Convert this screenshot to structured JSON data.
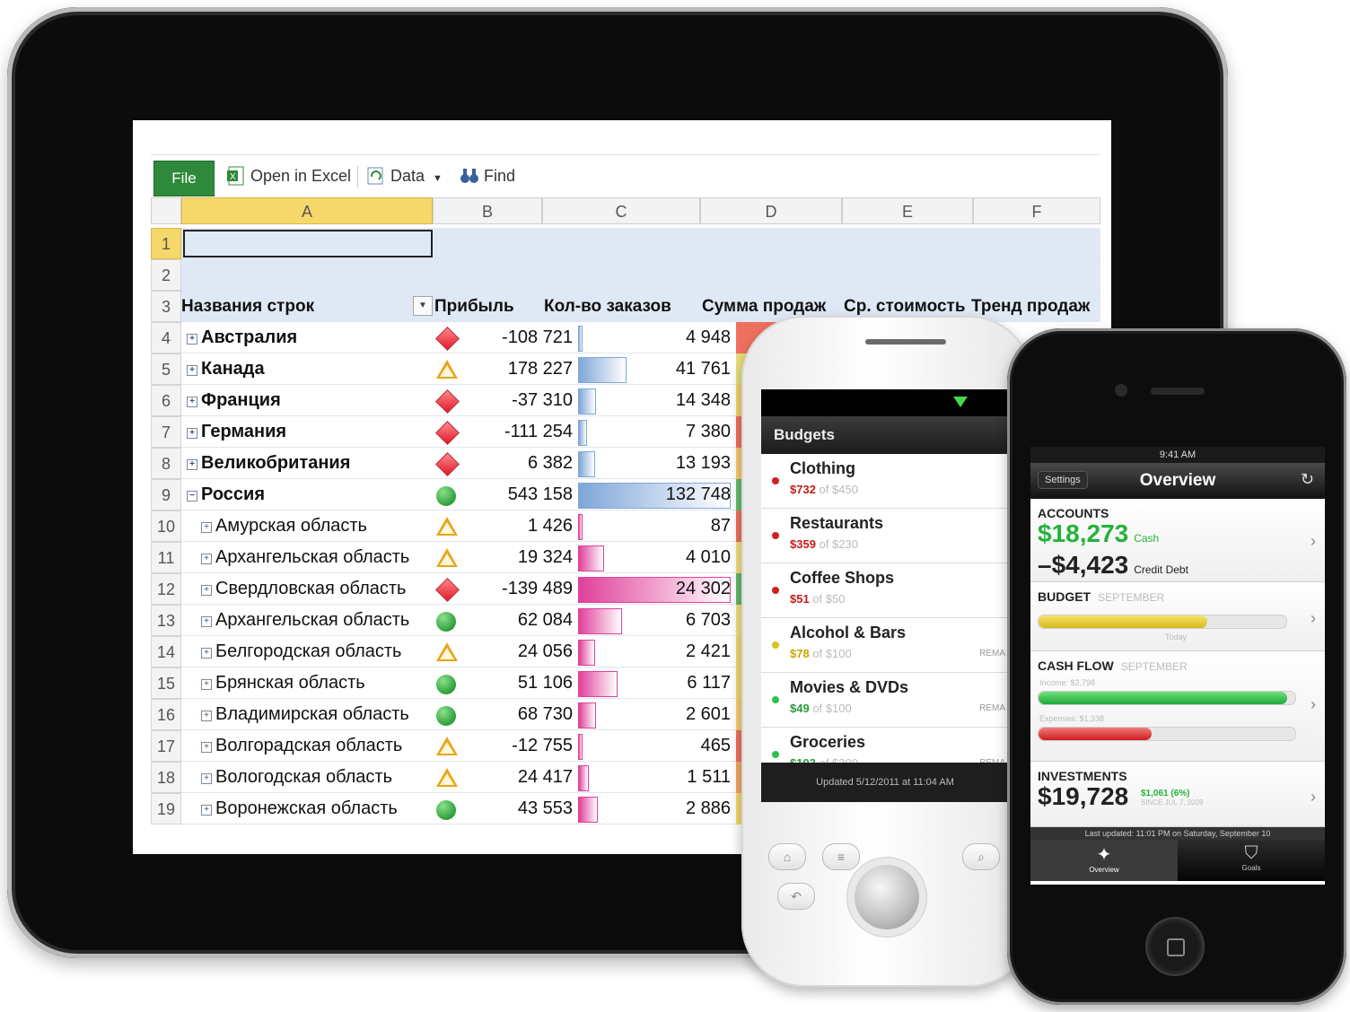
{
  "toolbar": {
    "file": "File",
    "open_in_excel": "Open in Excel",
    "data": "Data",
    "find": "Find"
  },
  "columns": [
    "A",
    "B",
    "C",
    "D",
    "E",
    "F"
  ],
  "row_numbers": [
    "1",
    "2",
    "3",
    "4",
    "5",
    "6",
    "7",
    "8",
    "9",
    "10",
    "11",
    "12",
    "13",
    "14",
    "15",
    "16",
    "17",
    "18",
    "19"
  ],
  "headers": {
    "row_labels": "Названия строк",
    "profit": "Прибыль",
    "orders": "Кол-во заказов",
    "sales_sum": "Сумма продаж",
    "avg_cost": "Ср. стоимость",
    "sales_trend": "Тренд продаж"
  },
  "rows": [
    {
      "name": "Австралия",
      "level": 0,
      "indicator": "diamond",
      "profit": "-108 721",
      "orders": "4 948",
      "order_bar": 0.02,
      "bar_color": "#7fa6d8",
      "heat": "#f0705f"
    },
    {
      "name": "Канада",
      "level": 0,
      "indicator": "triangle",
      "profit": "178 227",
      "orders": "41 761",
      "order_bar": 0.31,
      "bar_color": "#7fa6d8",
      "heat": "#e8dd7a"
    },
    {
      "name": "Франция",
      "level": 0,
      "indicator": "diamond",
      "profit": "-37 310",
      "orders": "14 348",
      "order_bar": 0.11,
      "bar_color": "#7fa6d8",
      "heat": "#f4d36c"
    },
    {
      "name": "Германия",
      "level": 0,
      "indicator": "diamond",
      "profit": "-111 254",
      "orders": "7 380",
      "order_bar": 0.05,
      "bar_color": "#7fa6d8",
      "heat": "#f0705f"
    },
    {
      "name": "Великобритания",
      "level": 0,
      "indicator": "diamond",
      "profit": "6 382",
      "orders": "13 193",
      "order_bar": 0.1,
      "bar_color": "#7fa6d8",
      "heat": "#f7c96b"
    },
    {
      "name": "Россия",
      "level": 0,
      "expanded": true,
      "indicator": "circle",
      "profit": "543 158",
      "orders": "132 748",
      "order_bar": 1.0,
      "bar_color": "#7fa6d8",
      "heat": "#66bb6a"
    },
    {
      "name": "Амурская область",
      "level": 1,
      "indicator": "triangle",
      "profit": "1 426",
      "orders": "87",
      "order_bar": 0.0,
      "bar_color": "#e0409a",
      "heat": "#f0705f"
    },
    {
      "name": "Архангельская область",
      "level": 1,
      "indicator": "triangle",
      "profit": "19 324",
      "orders": "4 010",
      "order_bar": 0.16,
      "bar_color": "#e0409a",
      "heat": "#f3dd78"
    },
    {
      "name": "Свердловская область",
      "level": 1,
      "indicator": "diamond",
      "profit": "-139 489",
      "orders": "24 302",
      "order_bar": 1.0,
      "bar_color": "#e0409a",
      "heat": "#63b969"
    },
    {
      "name": "Архангельская область",
      "level": 1,
      "indicator": "circle",
      "profit": "62 084",
      "orders": "6 703",
      "order_bar": 0.28,
      "bar_color": "#e0409a",
      "heat": "#f1e07c"
    },
    {
      "name": "Белгородская область",
      "level": 1,
      "indicator": "triangle",
      "profit": "24 056",
      "orders": "2 421",
      "order_bar": 0.1,
      "bar_color": "#e0409a",
      "heat": "#f4d870"
    },
    {
      "name": "Брянская область",
      "level": 1,
      "indicator": "circle",
      "profit": "51 106",
      "orders": "6 117",
      "order_bar": 0.25,
      "bar_color": "#e0409a",
      "heat": "#f4d870"
    },
    {
      "name": "Владимирская область",
      "level": 1,
      "indicator": "circle",
      "profit": "68 730",
      "orders": "2 601",
      "order_bar": 0.11,
      "bar_color": "#e0409a",
      "heat": "#f7ce6e"
    },
    {
      "name": "Волгорадская область",
      "level": 1,
      "indicator": "triangle",
      "profit": "-12 755",
      "orders": "465",
      "order_bar": 0.02,
      "bar_color": "#e0409a",
      "heat": "#f0705f"
    },
    {
      "name": "Вологодская область",
      "level": 1,
      "indicator": "triangle",
      "profit": "24 417",
      "orders": "1 511",
      "order_bar": 0.06,
      "bar_color": "#e0409a",
      "heat": "#f4a761"
    },
    {
      "name": "Воронежская область",
      "level": 1,
      "indicator": "circle",
      "profit": "43 553",
      "orders": "2 886",
      "order_bar": 0.12,
      "bar_color": "#e0409a",
      "heat": "#f7d66f"
    }
  ],
  "android": {
    "header": "Budgets",
    "items": [
      {
        "title": "Clothing",
        "spent": "$732",
        "of": "of $450",
        "dot": "#d02020",
        "spent_color": "#c41a1a"
      },
      {
        "title": "Restaurants",
        "spent": "$359",
        "of": "of $230",
        "dot": "#d02020",
        "spent_color": "#c41a1a"
      },
      {
        "title": "Coffee Shops",
        "spent": "$51",
        "of": "of $50",
        "dot": "#d02020",
        "spent_color": "#c41a1a"
      },
      {
        "title": "Alcohol & Bars",
        "spent": "$78",
        "of": "of $100",
        "dot": "#e0c020",
        "spent_color": "#c9a400",
        "remaining": "REMA"
      },
      {
        "title": "Movies & DVDs",
        "spent": "$49",
        "of": "of $100",
        "dot": "#2fbf4f",
        "spent_color": "#2a9a3a",
        "remaining": "REMA"
      },
      {
        "title": "Groceries",
        "spent": "$103",
        "of": "of $300",
        "dot": "#2fbf4f",
        "spent_color": "#2a9a3a",
        "remaining": "REMA"
      }
    ],
    "footer": "Updated 5/12/2011 at 11:04 AM"
  },
  "iphone": {
    "status": "9:41 AM",
    "settings": "Settings",
    "title": "Overview",
    "accounts_label": "ACCOUNTS",
    "cash_value": "$18,273",
    "cash_label": "Cash",
    "debt_value": "–$4,423",
    "debt_label": "Credit Debt",
    "budget_label": "BUDGET",
    "budget_month": "SEPTEMBER",
    "budget_fill": 0.68,
    "today_label": "Today",
    "cashflow_label": "CASH FLOW",
    "cashflow_month": "SEPTEMBER",
    "income_label": "Income: $3,798",
    "income_fill": 0.97,
    "expenses_label": "Expenses: $1,338",
    "expenses_fill": 0.44,
    "investments_label": "INVESTMENTS",
    "investments_value": "$19,728",
    "investments_change": "$1,061 (6%)",
    "investments_since": "SINCE JUL 7, 2009",
    "updated": "Last updated: 11:01 PM on Saturday, September 10",
    "tab_overview": "Overview",
    "tab_goals": "Goals"
  }
}
